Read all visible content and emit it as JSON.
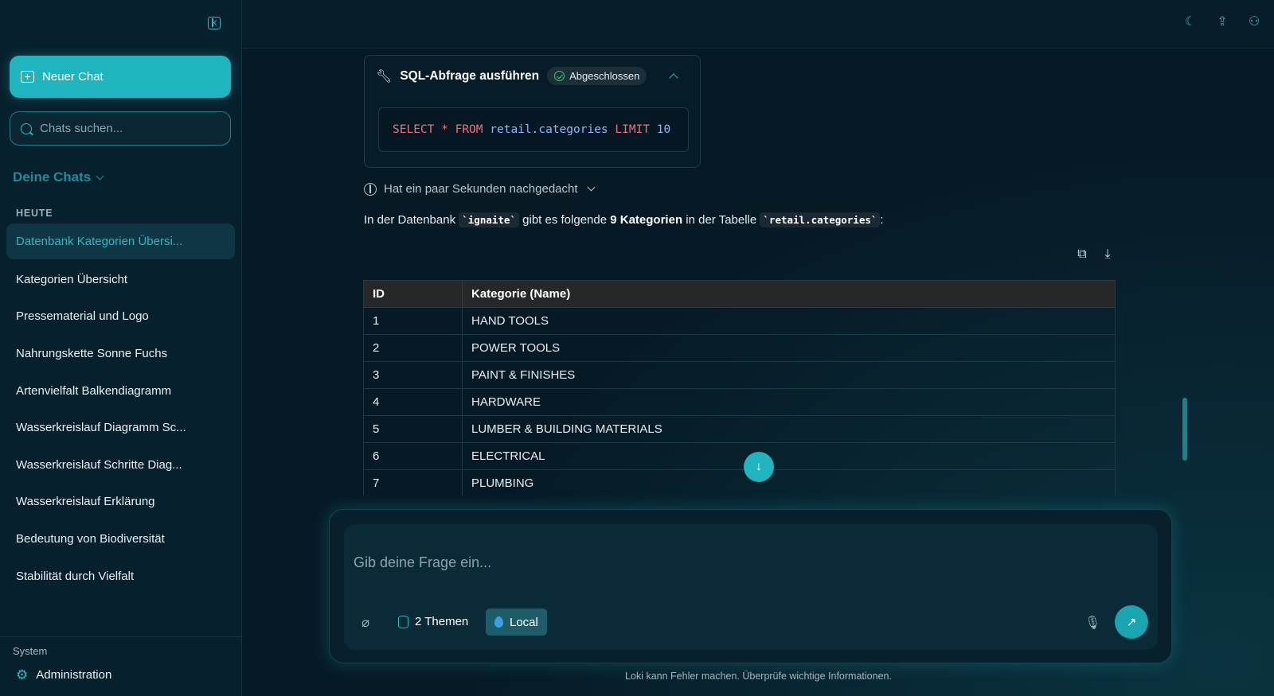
{
  "sidebar": {
    "new_chat_label": "Neuer Chat",
    "search_placeholder": "Chats suchen...",
    "section_title": "Deine Chats",
    "group_label": "HEUTE",
    "chats": [
      "Datenbank Kategorien Übersi...",
      "Kategorien Übersicht",
      "Pressematerial und Logo",
      "Nahrungskette Sonne Fuchs",
      "Artenvielfalt Balkendiagramm",
      "Wasserkreislauf Diagramm Sc...",
      "Wasserkreislauf Schritte Diag...",
      "Wasserkreislauf Erklärung",
      "Bedeutung von Biodiversität",
      "Stabilität durch Vielfalt"
    ],
    "system_label": "System",
    "admin_label": "Administration"
  },
  "tool_call": {
    "title": "SQL-Abfrage ausführen",
    "status": "Abgeschlossen",
    "sql": {
      "select": "SELECT",
      "star": "*",
      "from": "FROM",
      "table": "retail.categories",
      "limit": "LIMIT",
      "limit_value": "10"
    }
  },
  "thought_label": "Hat ein paar Sekunden nachgedacht",
  "answer": {
    "part1": "In der Datenbank ",
    "db_code": "`ignaite`",
    "part2": " gibt es folgende ",
    "bold": "9 Kategorien",
    "part3": " in der Tabelle ",
    "table_code": "`retail.categories`",
    "part4": ":"
  },
  "table": {
    "headers": [
      "ID",
      "Kategorie (Name)"
    ],
    "rows": [
      [
        "1",
        "HAND TOOLS"
      ],
      [
        "2",
        "POWER TOOLS"
      ],
      [
        "3",
        "PAINT & FINISHES"
      ],
      [
        "4",
        "HARDWARE"
      ],
      [
        "5",
        "LUMBER & BUILDING MATERIALS"
      ],
      [
        "6",
        "ELECTRICAL"
      ],
      [
        "7",
        "PLUMBING"
      ]
    ]
  },
  "composer": {
    "placeholder": "Gib deine Frage ein...",
    "topics_label": "2 Themen",
    "model_label": "Local"
  },
  "disclaimer": "Loki kann Fehler machen. Überprüfe wichtige Informationen.",
  "colors": {
    "accent": "#1fb5be",
    "background": "#061a26",
    "sidebar": "#07202d"
  }
}
